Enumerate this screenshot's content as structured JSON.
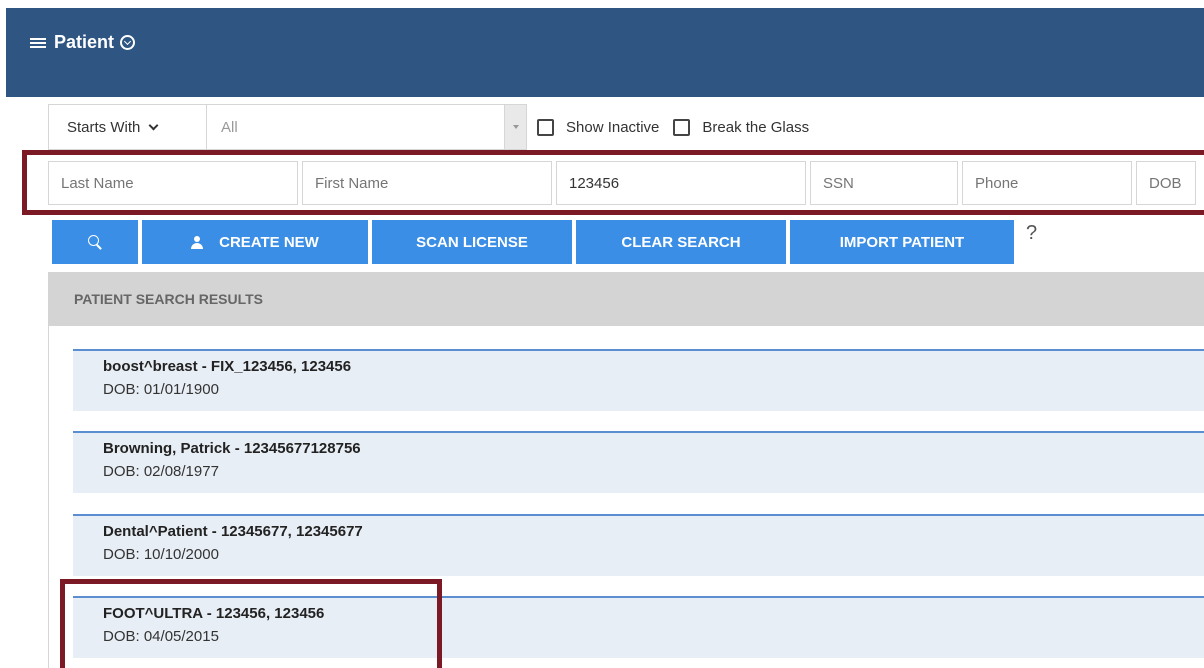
{
  "header": {
    "title": "Patient"
  },
  "filters": {
    "match_mode": "Starts With",
    "scope": "All",
    "show_inactive_label": "Show Inactive",
    "break_glass_label": "Break the Glass"
  },
  "search_fields": {
    "last_name_placeholder": "Last Name",
    "first_name_placeholder": "First Name",
    "id_value": "123456",
    "ssn_placeholder": "SSN",
    "phone_placeholder": "Phone",
    "dob_placeholder": "DOB"
  },
  "buttons": {
    "create_new": "CREATE NEW",
    "scan_license": "SCAN LICENSE",
    "clear_search": "CLEAR SEARCH",
    "import_patient": "IMPORT PATIENT",
    "help": "?"
  },
  "results": {
    "title": "PATIENT SEARCH RESULTS",
    "items": [
      {
        "name": "boost^breast - FIX_123456, 123456",
        "dob": "DOB: 01/01/1900"
      },
      {
        "name": "Browning, Patrick - 12345677128756",
        "dob": "DOB: 02/08/1977"
      },
      {
        "name": "Dental^Patient - 12345677, 12345677",
        "dob": "DOB: 10/10/2000"
      },
      {
        "name": "FOOT^ULTRA - 123456, 123456",
        "dob": "DOB: 04/05/2015"
      }
    ]
  },
  "colors": {
    "header_bg": "#2f5683",
    "button_bg": "#3b8ee6",
    "highlight_border": "#7b1a24",
    "result_bg": "#e8eef5"
  }
}
